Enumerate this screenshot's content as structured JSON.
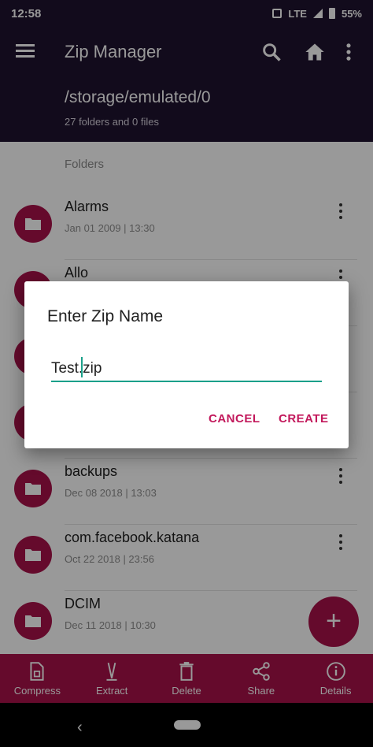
{
  "status_bar": {
    "time": "12:58",
    "network": "LTE",
    "battery": "55%"
  },
  "app_bar": {
    "title": "Zip Manager",
    "path": "/storage/emulated/0",
    "counts": "27 folders and 0 files"
  },
  "list": {
    "section_label": "Folders",
    "items": [
      {
        "name": "Alarms",
        "date": "Jan 01 2009 | 13:30"
      },
      {
        "name": "Allo",
        "date": ""
      },
      {
        "name": "",
        "date": ""
      },
      {
        "name": "",
        "date": ""
      },
      {
        "name": "backups",
        "date": "Dec 08 2018 | 13:03"
      },
      {
        "name": "com.facebook.katana",
        "date": "Oct 22 2018 | 23:56"
      },
      {
        "name": "DCIM",
        "date": "Dec 11 2018 | 10:30"
      }
    ]
  },
  "dialog": {
    "title": "Enter Zip Name",
    "input_value": "Test.zip",
    "cancel_label": "CANCEL",
    "create_label": "CREATE"
  },
  "fab": {
    "icon": "plus-icon",
    "label": "+"
  },
  "bottom_nav": {
    "items": [
      {
        "label": "Compress",
        "icon": "compress-icon"
      },
      {
        "label": "Extract",
        "icon": "extract-icon"
      },
      {
        "label": "Delete",
        "icon": "delete-icon"
      },
      {
        "label": "Share",
        "icon": "share-icon"
      },
      {
        "label": "Details",
        "icon": "info-icon"
      }
    ]
  },
  "colors": {
    "app_bar": "#1f1330",
    "accent": "#a8124a",
    "dialog_button": "#c2185b",
    "input_underline": "#1aa08a"
  }
}
